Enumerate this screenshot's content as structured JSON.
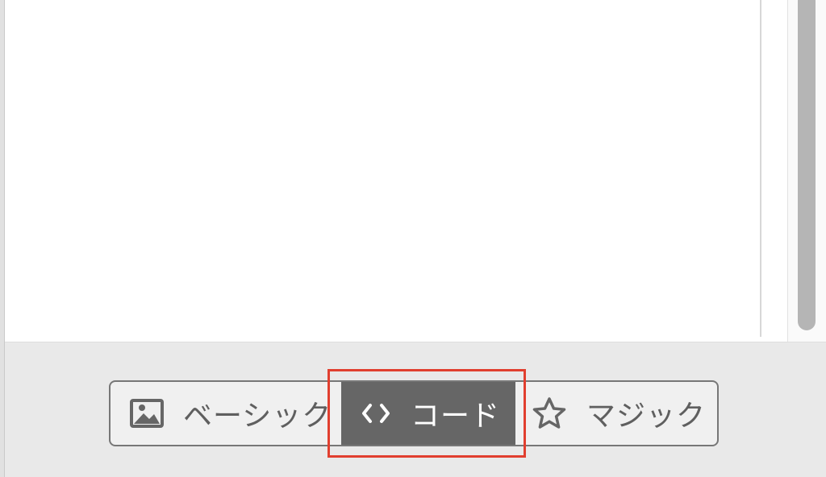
{
  "mode_switcher": {
    "basic": {
      "label": "ベーシック",
      "icon": "image-icon"
    },
    "code": {
      "label": "コード",
      "icon": "code-brackets-icon"
    },
    "magic": {
      "label": "マジック",
      "icon": "star-icon"
    },
    "selected": "code"
  },
  "colors": {
    "selected_segment": "#666666",
    "highlight_box": "#e13f2f",
    "text": "#5f5f5f"
  }
}
